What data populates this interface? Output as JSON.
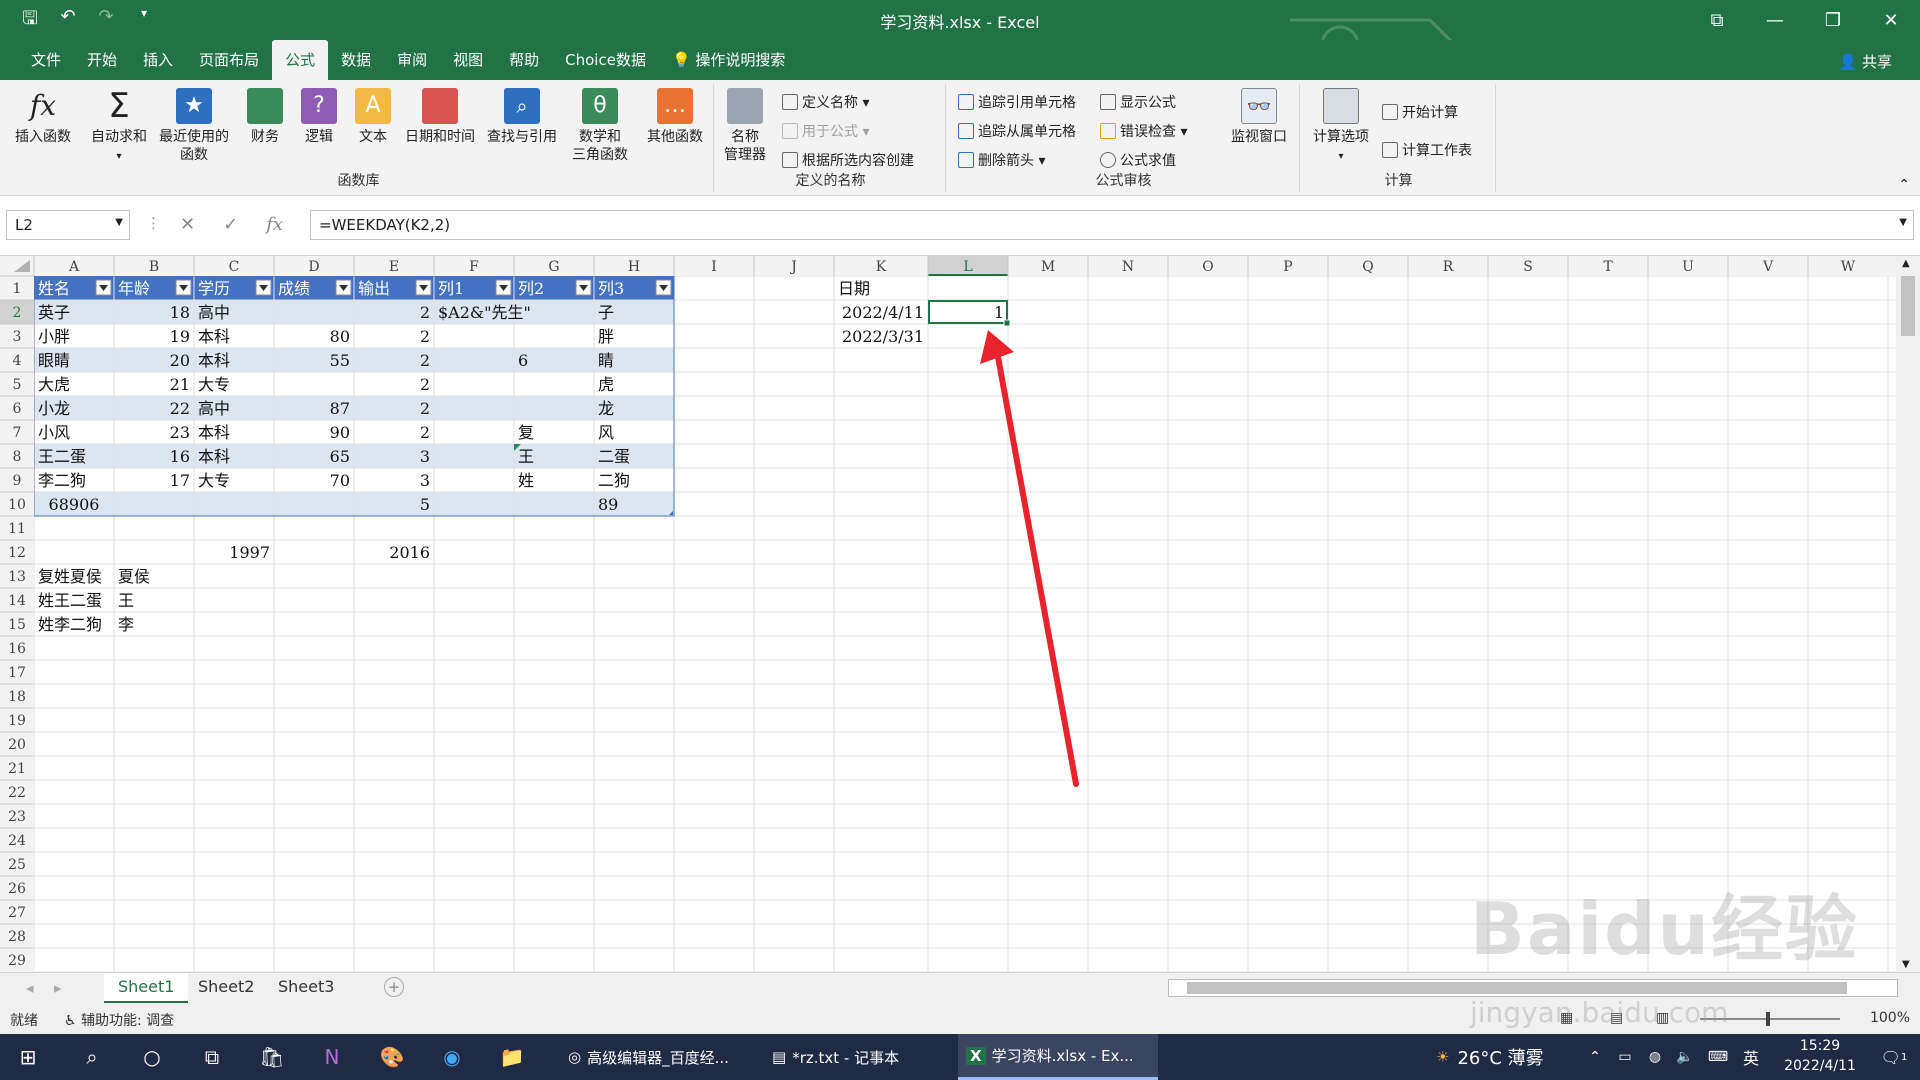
{
  "title": "学习资料.xlsx  -  Excel",
  "menu": [
    "文件",
    "开始",
    "插入",
    "页面布局",
    "公式",
    "数据",
    "审阅",
    "视图",
    "帮助",
    "Choice数据",
    "操作说明搜索"
  ],
  "share": "共享",
  "ribbon": {
    "insert_function": "插入函数",
    "autosum": "自动求和",
    "recent": "最近使用的\n函数",
    "finance": "财务",
    "logic": "逻辑",
    "text": "文本",
    "datetime": "日期和时间",
    "lookup": "查找与引用",
    "math": "数学和\n三角函数",
    "other": "其他函数",
    "group_library": "函数库",
    "name_manager": "名称\n管理器",
    "define_name": "定义名称",
    "use_in_formula": "用于公式",
    "create_from_sel": "根据所选内容创建",
    "group_names": "定义的名称",
    "trace_precedents": "追踪引用单元格",
    "trace_dependents": "追踪从属单元格",
    "remove_arrows": "删除箭头",
    "show_formulas": "显示公式",
    "error_check": "错误检查",
    "evaluate": "公式求值",
    "watch": "监视窗口",
    "group_audit": "公式审核",
    "calc_options": "计算选项",
    "calc_now": "开始计算",
    "calc_sheet": "计算工作表",
    "group_calc": "计算"
  },
  "namebox": "L2",
  "formula": "=WEEKDAY(K2,2)",
  "columns": [
    "A",
    "B",
    "C",
    "D",
    "E",
    "F",
    "G",
    "H",
    "I",
    "J",
    "K",
    "L",
    "M",
    "N",
    "O",
    "P",
    "Q",
    "R",
    "S",
    "T",
    "U",
    "V",
    "W"
  ],
  "rows": [
    "1",
    "2",
    "3",
    "4",
    "5",
    "6",
    "7",
    "8",
    "9",
    "10",
    "11",
    "12",
    "13",
    "14",
    "15",
    "16",
    "17",
    "18",
    "19",
    "20",
    "21",
    "22",
    "23",
    "24",
    "25",
    "26",
    "27",
    "28",
    "29"
  ],
  "cells": [
    {
      "c": 0,
      "r": 0,
      "v": "姓名",
      "a": "l",
      "h": 1
    },
    {
      "c": 1,
      "r": 0,
      "v": "年龄",
      "a": "l",
      "h": 1
    },
    {
      "c": 2,
      "r": 0,
      "v": "学历",
      "a": "l",
      "h": 1
    },
    {
      "c": 3,
      "r": 0,
      "v": "成绩",
      "a": "l",
      "h": 1
    },
    {
      "c": 4,
      "r": 0,
      "v": "输出",
      "a": "l",
      "h": 1
    },
    {
      "c": 5,
      "r": 0,
      "v": "列1",
      "a": "l",
      "h": 1
    },
    {
      "c": 6,
      "r": 0,
      "v": "列2",
      "a": "l",
      "h": 1
    },
    {
      "c": 7,
      "r": 0,
      "v": "列3",
      "a": "l",
      "h": 1
    },
    {
      "c": 0,
      "r": 1,
      "v": "英子",
      "a": "l"
    },
    {
      "c": 1,
      "r": 1,
      "v": "18",
      "a": "r"
    },
    {
      "c": 2,
      "r": 1,
      "v": "高中",
      "a": "l"
    },
    {
      "c": 4,
      "r": 1,
      "v": "2",
      "a": "r"
    },
    {
      "c": 5,
      "r": 1,
      "v": "$A2&\"先生\"",
      "a": "l"
    },
    {
      "c": 7,
      "r": 1,
      "v": "子",
      "a": "l"
    },
    {
      "c": 0,
      "r": 2,
      "v": "小胖",
      "a": "l"
    },
    {
      "c": 1,
      "r": 2,
      "v": "19",
      "a": "r"
    },
    {
      "c": 2,
      "r": 2,
      "v": "本科",
      "a": "l"
    },
    {
      "c": 3,
      "r": 2,
      "v": "80",
      "a": "r"
    },
    {
      "c": 4,
      "r": 2,
      "v": "2",
      "a": "r"
    },
    {
      "c": 7,
      "r": 2,
      "v": "胖",
      "a": "l"
    },
    {
      "c": 0,
      "r": 3,
      "v": "眼睛",
      "a": "l"
    },
    {
      "c": 1,
      "r": 3,
      "v": "20",
      "a": "r"
    },
    {
      "c": 2,
      "r": 3,
      "v": "本科",
      "a": "l"
    },
    {
      "c": 3,
      "r": 3,
      "v": "55",
      "a": "r"
    },
    {
      "c": 4,
      "r": 3,
      "v": "2",
      "a": "r"
    },
    {
      "c": 6,
      "r": 3,
      "v": "6",
      "a": "l"
    },
    {
      "c": 7,
      "r": 3,
      "v": "睛",
      "a": "l"
    },
    {
      "c": 0,
      "r": 4,
      "v": "大虎",
      "a": "l"
    },
    {
      "c": 1,
      "r": 4,
      "v": "21",
      "a": "r"
    },
    {
      "c": 2,
      "r": 4,
      "v": "大专",
      "a": "l"
    },
    {
      "c": 4,
      "r": 4,
      "v": "2",
      "a": "r"
    },
    {
      "c": 7,
      "r": 4,
      "v": "虎",
      "a": "l"
    },
    {
      "c": 0,
      "r": 5,
      "v": "小龙",
      "a": "l"
    },
    {
      "c": 1,
      "r": 5,
      "v": "22",
      "a": "r"
    },
    {
      "c": 2,
      "r": 5,
      "v": "高中",
      "a": "l"
    },
    {
      "c": 3,
      "r": 5,
      "v": "87",
      "a": "r"
    },
    {
      "c": 4,
      "r": 5,
      "v": "2",
      "a": "r"
    },
    {
      "c": 7,
      "r": 5,
      "v": "龙",
      "a": "l"
    },
    {
      "c": 0,
      "r": 6,
      "v": "小风",
      "a": "l"
    },
    {
      "c": 1,
      "r": 6,
      "v": "23",
      "a": "r"
    },
    {
      "c": 2,
      "r": 6,
      "v": "本科",
      "a": "l"
    },
    {
      "c": 3,
      "r": 6,
      "v": "90",
      "a": "r"
    },
    {
      "c": 4,
      "r": 6,
      "v": "2",
      "a": "r"
    },
    {
      "c": 6,
      "r": 6,
      "v": "复",
      "a": "l"
    },
    {
      "c": 7,
      "r": 6,
      "v": "风",
      "a": "l"
    },
    {
      "c": 0,
      "r": 7,
      "v": "王二蛋",
      "a": "l"
    },
    {
      "c": 1,
      "r": 7,
      "v": "16",
      "a": "r"
    },
    {
      "c": 2,
      "r": 7,
      "v": "本科",
      "a": "l"
    },
    {
      "c": 3,
      "r": 7,
      "v": "65",
      "a": "r"
    },
    {
      "c": 4,
      "r": 7,
      "v": "3",
      "a": "r"
    },
    {
      "c": 6,
      "r": 7,
      "v": "王",
      "a": "l"
    },
    {
      "c": 7,
      "r": 7,
      "v": "二蛋",
      "a": "l"
    },
    {
      "c": 0,
      "r": 8,
      "v": "李二狗",
      "a": "l"
    },
    {
      "c": 1,
      "r": 8,
      "v": "17",
      "a": "r"
    },
    {
      "c": 2,
      "r": 8,
      "v": "大专",
      "a": "l"
    },
    {
      "c": 3,
      "r": 8,
      "v": "70",
      "a": "r"
    },
    {
      "c": 4,
      "r": 8,
      "v": "3",
      "a": "r"
    },
    {
      "c": 6,
      "r": 8,
      "v": "姓",
      "a": "l"
    },
    {
      "c": 7,
      "r": 8,
      "v": "二狗",
      "a": "l"
    },
    {
      "c": 0,
      "r": 9,
      "v": "68906",
      "a": "c"
    },
    {
      "c": 4,
      "r": 9,
      "v": "5",
      "a": "r"
    },
    {
      "c": 7,
      "r": 9,
      "v": "89",
      "a": "l"
    },
    {
      "c": 2,
      "r": 11,
      "v": "1997",
      "a": "r"
    },
    {
      "c": 4,
      "r": 11,
      "v": "2016",
      "a": "r"
    },
    {
      "c": 0,
      "r": 12,
      "v": "复姓夏侯",
      "a": "l"
    },
    {
      "c": 1,
      "r": 12,
      "v": "夏侯",
      "a": "l"
    },
    {
      "c": 0,
      "r": 13,
      "v": "姓王二蛋",
      "a": "l"
    },
    {
      "c": 1,
      "r": 13,
      "v": "王",
      "a": "l"
    },
    {
      "c": 0,
      "r": 14,
      "v": "姓李二狗",
      "a": "l"
    },
    {
      "c": 1,
      "r": 14,
      "v": "李",
      "a": "l"
    },
    {
      "c": 10,
      "r": 0,
      "v": "日期",
      "a": "l"
    },
    {
      "c": 10,
      "r": 1,
      "v": "2022/4/11",
      "a": "r"
    },
    {
      "c": 11,
      "r": 1,
      "v": "1",
      "a": "r"
    },
    {
      "c": 10,
      "r": 2,
      "v": "2022/3/31",
      "a": "r"
    }
  ],
  "selected_cell": "L2",
  "sheets": [
    "Sheet1",
    "Sheet2",
    "Sheet3"
  ],
  "status_ready": "就绪",
  "status_access": "辅助功能: 调查",
  "zoom": "100%",
  "watermark": "Baidu经验",
  "watermark_url": "jingyan.baidu.com",
  "taskbar": {
    "app1": "高级编辑器_百度经...",
    "app2": "*rz.txt - 记事本",
    "app3": "学习资料.xlsx - Ex...",
    "weather": "26°C  薄雾",
    "ime": "英",
    "time": "15:29",
    "date": "2022/4/11",
    "notif": "1"
  },
  "colors": {
    "excel_green": "#217346",
    "table_band": "#dce6f1",
    "table_header": "#4472c4",
    "arrow": "#e8232b"
  }
}
